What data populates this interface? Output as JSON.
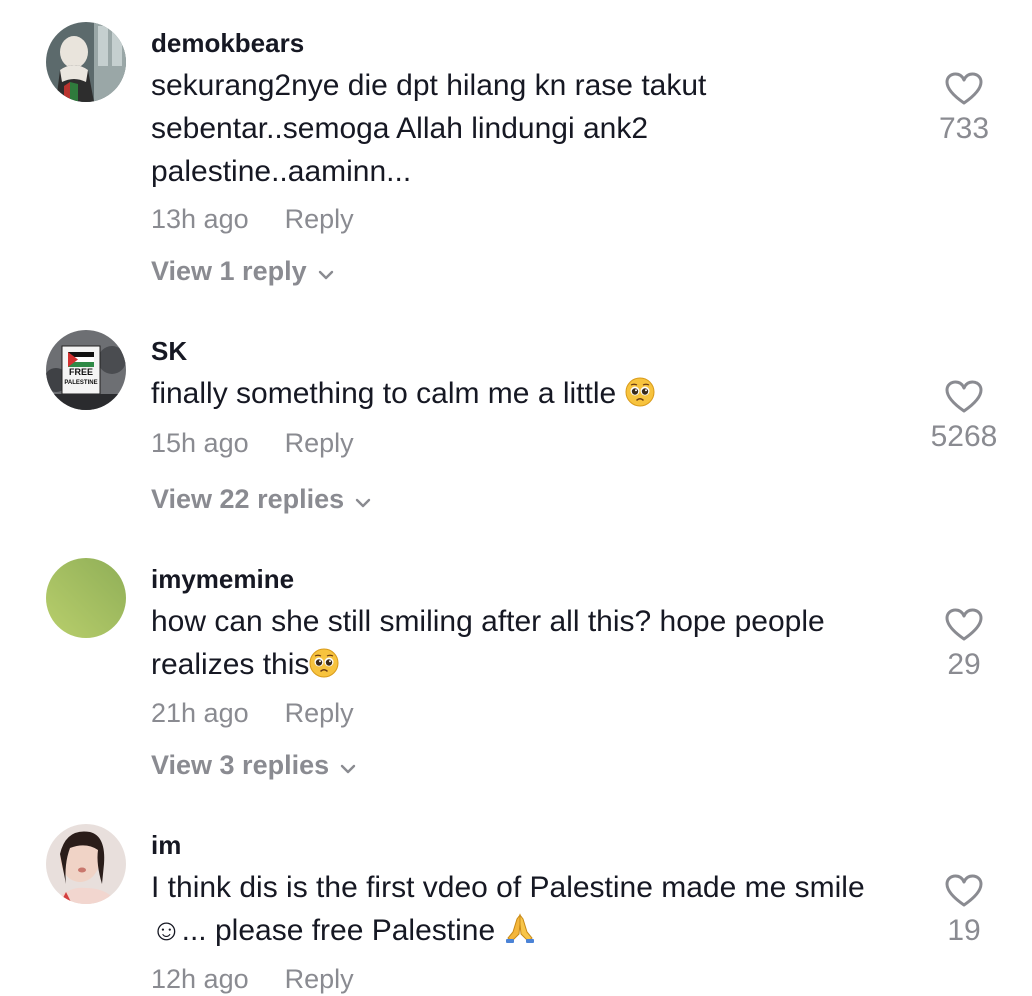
{
  "comments": [
    {
      "username": "demokbears",
      "text": "sekurang2nye die dpt hilang kn rase takut sebentar..semoga Allah lindungi ank2 palestine..aaminn...",
      "time": "13h ago",
      "reply_label": "Reply",
      "view_replies": "View 1 reply",
      "likes": "733"
    },
    {
      "username": "SK",
      "text": "finally something to calm me a little",
      "emoji": "pleading-face-icon",
      "time": "15h ago",
      "reply_label": "Reply",
      "view_replies": "View 22 replies",
      "likes": "5268",
      "avatar_sign_text": "FREE PALESTINE"
    },
    {
      "username": "imymemine",
      "text": "how can she still smiling after all this? hope people realizes this",
      "emoji": "pleading-face-icon",
      "time": "21h ago",
      "reply_label": "Reply",
      "view_replies": "View 3 replies",
      "likes": "29",
      "avatar_color": "#a4bf62"
    },
    {
      "username": "im",
      "text": "I think dis is the first vdeo of Palestine made me smile ☺... please free Palestine",
      "emoji": "folded-hands-icon",
      "time": "12h ago",
      "reply_label": "Reply",
      "likes": "19"
    }
  ],
  "colors": {
    "text_primary": "#161823",
    "text_secondary": "#8a8b91",
    "heart_outline": "#8a8b91",
    "background": "#ffffff"
  }
}
